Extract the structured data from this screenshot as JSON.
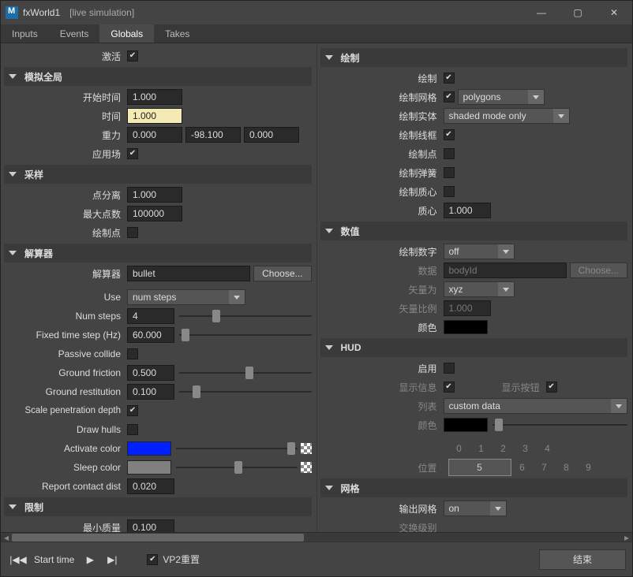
{
  "window": {
    "title": "fxWorld1",
    "subtitle": "[live simulation]"
  },
  "tabs": [
    "Inputs",
    "Events",
    "Globals",
    "Takes"
  ],
  "active_tab": "Globals",
  "top": {
    "activate_label": "激活",
    "activate": true
  },
  "left": {
    "sim": {
      "head": "模拟全局",
      "start_time_label": "开始时间",
      "start_time": "1.000",
      "time_label": "时间",
      "time": "1.000",
      "gravity_label": "重力",
      "gx": "0.000",
      "gy": "-98.100",
      "gz": "0.000",
      "use_scene_label": "应用场",
      "use_scene": true
    },
    "sample": {
      "head": "采样",
      "point_sep_label": "点分离",
      "point_sep": "1.000",
      "max_pts_label": "最大点数",
      "max_pts": "100000",
      "draw_pts_label": "绘制点",
      "draw_pts": false
    },
    "solver": {
      "head": "解算器",
      "solver_label": "解算器",
      "solver_val": "bullet",
      "choose": "Choose...",
      "use_label": "Use",
      "use_val": "num steps",
      "num_steps_label": "Num steps",
      "num_steps": "4",
      "fixed_ts_label": "Fixed time step (Hz)",
      "fixed_ts": "60.000",
      "passive_collide_label": "Passive collide",
      "passive_collide": false,
      "ground_friction_label": "Ground friction",
      "ground_friction": "0.500",
      "ground_rest_label": "Ground restitution",
      "ground_rest": "0.100",
      "scale_pen_label": "Scale penetration depth",
      "scale_pen": true,
      "draw_hulls_label": "Draw hulls",
      "draw_hulls": false,
      "activate_color_label": "Activate color",
      "activate_color": "#0020ff",
      "sleep_color_label": "Sleep color",
      "sleep_color": "#808080",
      "report_contact_label": "Report contact dist",
      "report_contact": "0.020"
    },
    "limit": {
      "head": "限制",
      "min_mass_label": "最小质量",
      "min_mass": "0.100"
    }
  },
  "right": {
    "draw": {
      "head": "绘制",
      "draw_label": "绘制",
      "draw": true,
      "draw_mesh_label": "绘制网格",
      "draw_mesh": true,
      "draw_mesh_mode": "polygons",
      "draw_entity_label": "绘制实体",
      "draw_entity_mode": "shaded mode only",
      "draw_wire_label": "绘制线框",
      "draw_wire": true,
      "draw_pts_label": "绘制点",
      "draw_pts": false,
      "draw_spring_label": "绘制弹簧",
      "draw_spring": false,
      "draw_centroid_label": "绘制质心",
      "draw_centroid": false,
      "centroid_label": "质心",
      "centroid": "1.000"
    },
    "numeric": {
      "head": "数值",
      "draw_num_label": "绘制数字",
      "draw_num_val": "off",
      "data_label": "数据",
      "data_val": "bodyId",
      "choose": "Choose...",
      "vec_as_label": "矢量为",
      "vec_as_val": "xyz",
      "vec_scale_label": "矢量比例",
      "vec_scale": "1.000",
      "color_label": "颜色",
      "color": "#000000"
    },
    "hud": {
      "head": "HUD",
      "enabled_label": "启用",
      "enabled": false,
      "show_info_label": "显示信息",
      "show_info": true,
      "show_btn_label": "显示按钮",
      "show_btn": true,
      "list_label": "列表",
      "list_val": "custom data",
      "color_label": "颜色",
      "color": "#000000",
      "pos_label": "位置",
      "grid": [
        "0",
        "1",
        "2",
        "3",
        "4",
        "5",
        "6",
        "7",
        "8",
        "9"
      ],
      "grid_sel": 5
    },
    "mesh": {
      "head": "网格",
      "out_mesh_label": "输出网格",
      "out_mesh_val": "on",
      "replace_label": "交换级别"
    }
  },
  "footer": {
    "start_time": "Start time",
    "vp2_label": "VP2重置",
    "vp2": true,
    "end": "结束"
  }
}
